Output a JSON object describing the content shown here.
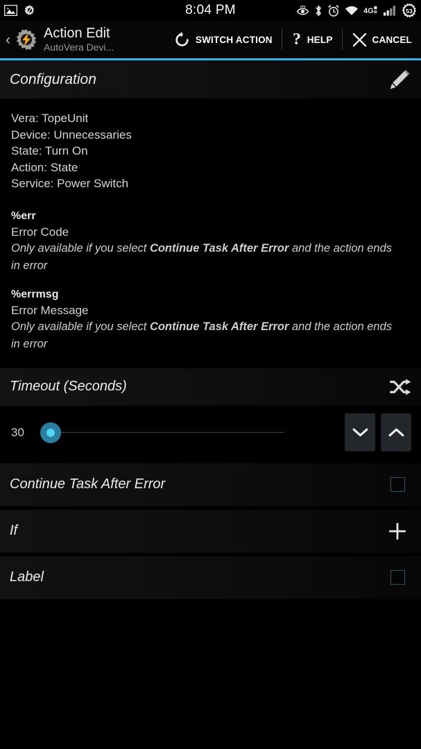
{
  "status_bar": {
    "time": "8:04 PM",
    "left_icons": [
      "image-icon",
      "gear-icon"
    ],
    "right_icons": [
      "eye-icon",
      "bluetooth-icon",
      "alarm-icon",
      "wifi-icon",
      "network-4g-icon",
      "signal-bars-icon"
    ],
    "battery_level": "53"
  },
  "action_bar": {
    "back_chevron": "‹",
    "app_icon": "tasker-gear-bolt-icon",
    "title": "Action Edit",
    "subtitle": "AutoVera Devi...",
    "actions": [
      {
        "icon": "refresh-rotate-icon",
        "label": "SWITCH ACTION"
      },
      {
        "icon": "question-mark-icon",
        "label": "HELP"
      },
      {
        "icon": "close-x-icon",
        "label": "CANCEL"
      }
    ]
  },
  "configuration": {
    "header": "Configuration",
    "edit_icon": "pencil-icon",
    "lines": [
      "Vera: TopeUnit",
      "Device: Unnecessaries",
      "State: Turn On",
      "Action: State",
      "Service: Power Switch"
    ],
    "variables": [
      {
        "name": "%err",
        "description": "Error Code",
        "note_before": "Only available if you select ",
        "note_bold": "Continue Task After Error",
        "note_after": " and the action ends in error"
      },
      {
        "name": "%errmsg",
        "description": "Error Message",
        "note_before": "Only available if you select ",
        "note_bold": "Continue Task After Error",
        "note_after": " and the action ends in error"
      }
    ]
  },
  "timeout": {
    "header": "Timeout (Seconds)",
    "shuffle_icon": "shuffle-icon",
    "value": "30",
    "decrement_icon": "chevron-down-icon",
    "increment_icon": "chevron-up-icon"
  },
  "options": [
    {
      "label": "Continue Task After Error",
      "control": "checkbox",
      "checked": false
    },
    {
      "label": "If",
      "control": "plus",
      "checked": false
    },
    {
      "label": "Label",
      "control": "checkbox",
      "checked": false
    }
  ],
  "colors": {
    "accent": "#33b5e5",
    "slider_thumb_inner": "#4fd2f5",
    "slider_thumb_outer": "#2b7f9e",
    "background": "#000000"
  }
}
